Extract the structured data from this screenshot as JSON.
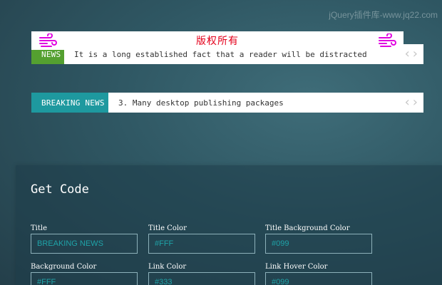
{
  "watermark": "jQuery插件库-www.jq22.com",
  "banner": {
    "label": "版权所有",
    "left_icon": "wind-icon",
    "right_icon": "wind-icon",
    "color": "#e4001b"
  },
  "ticker1": {
    "tag": "NEWS",
    "text": "It is a long established fact that a reader will be distracted",
    "tag_color": "#54a030",
    "prev_icon": "chevron-left-icon",
    "next_icon": "chevron-right-icon"
  },
  "ticker2": {
    "tag": "BREAKING NEWS",
    "text": "3. Many desktop publishing packages",
    "tag_color": "#1e999f",
    "prev_icon": "chevron-left-icon",
    "next_icon": "chevron-right-icon"
  },
  "panel": {
    "title": "Get Code",
    "fields": [
      {
        "label": "Title",
        "value": "BREAKING NEWS"
      },
      {
        "label": "Title Color",
        "value": "#FFF"
      },
      {
        "label": "Title Background Color",
        "value": "#099"
      },
      {
        "label": "Background Color",
        "value": "#FFF"
      },
      {
        "label": "Link Color",
        "value": "#333"
      },
      {
        "label": "Link Hover Color",
        "value": "#099"
      }
    ]
  }
}
